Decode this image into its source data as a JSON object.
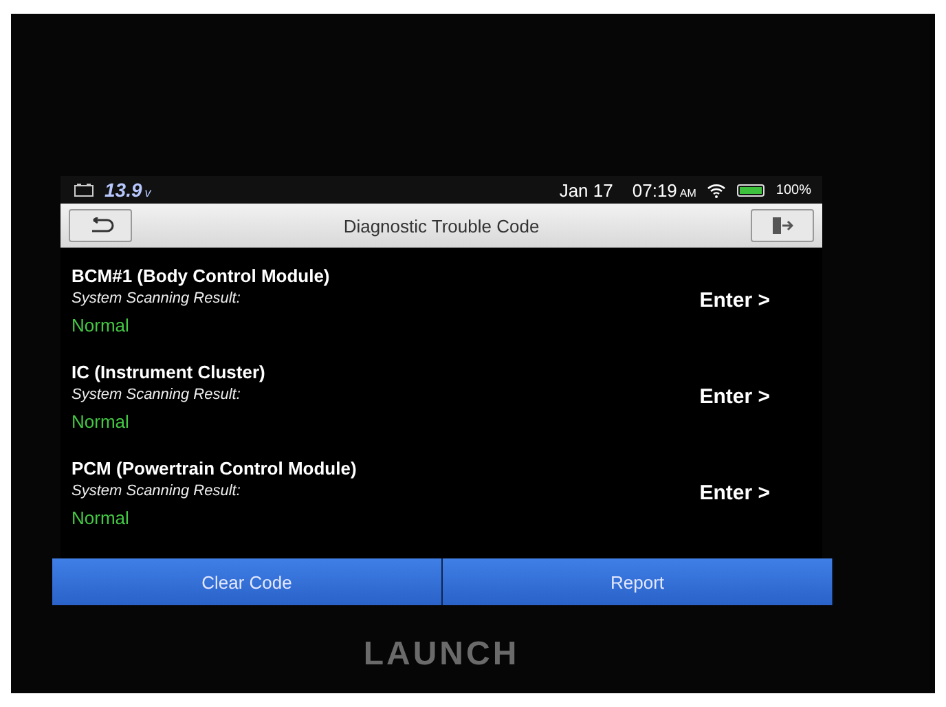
{
  "status_bar": {
    "voltage": "13.9",
    "voltage_unit": "v",
    "date": "Jan 17",
    "time": "07:19",
    "ampm": "AM",
    "battery": "100%",
    "battery_meter": {
      "level": 1
    }
  },
  "title_bar": {
    "title": "Diagnostic Trouble Code"
  },
  "modules": [
    {
      "name": "BCM#1 (Body Control Module)",
      "result_label": "System Scanning Result:",
      "result": "Normal",
      "action": "Enter >"
    },
    {
      "name": "IC (Instrument Cluster)",
      "result_label": "System Scanning Result:",
      "result": "Normal",
      "action": "Enter >"
    },
    {
      "name": "PCM (Powertrain Control Module)",
      "result_label": "System Scanning Result:",
      "result": "Normal",
      "action": "Enter >"
    }
  ],
  "buttons": [
    "Clear Code",
    "Report"
  ],
  "bezel_logo": "LAUNCH"
}
